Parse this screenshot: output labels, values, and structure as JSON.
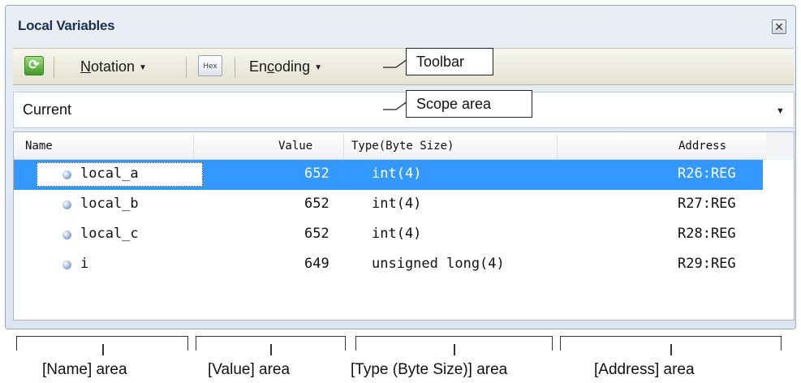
{
  "window": {
    "title": "Local Variables"
  },
  "toolbar": {
    "notation_label": "Notation",
    "notation_accel": "N",
    "notation_rest": "otation",
    "hex_label": "Hex",
    "encoding_pre": "En",
    "encoding_accel": "c",
    "encoding_rest": "oding"
  },
  "scope": {
    "value": "Current"
  },
  "grid": {
    "columns": [
      "Name",
      "Value",
      "Type(Byte Size)",
      "Address"
    ],
    "rows": [
      {
        "name": "local_a",
        "value": "652",
        "type": "int(4)",
        "address": "R26:REG",
        "selected": true
      },
      {
        "name": "local_b",
        "value": "652",
        "type": "int(4)",
        "address": "R27:REG",
        "selected": false
      },
      {
        "name": "local_c",
        "value": "652",
        "type": "int(4)",
        "address": "R28:REG",
        "selected": false
      },
      {
        "name": "i",
        "value": "649",
        "type": "unsigned long(4)",
        "address": "R29:REG",
        "selected": false
      }
    ]
  },
  "callouts": {
    "toolbar": "Toolbar",
    "scope": "Scope area"
  },
  "areas": {
    "name": "[Name] area",
    "value": "[Value] area",
    "type": "[Type (Byte Size)] area",
    "address": "[Address] area"
  },
  "icons": {
    "refresh": "refresh-icon",
    "hex": "hex-display-icon",
    "close": "close-icon",
    "dropdown": "chevron-down-icon",
    "variable": "variable-icon"
  }
}
